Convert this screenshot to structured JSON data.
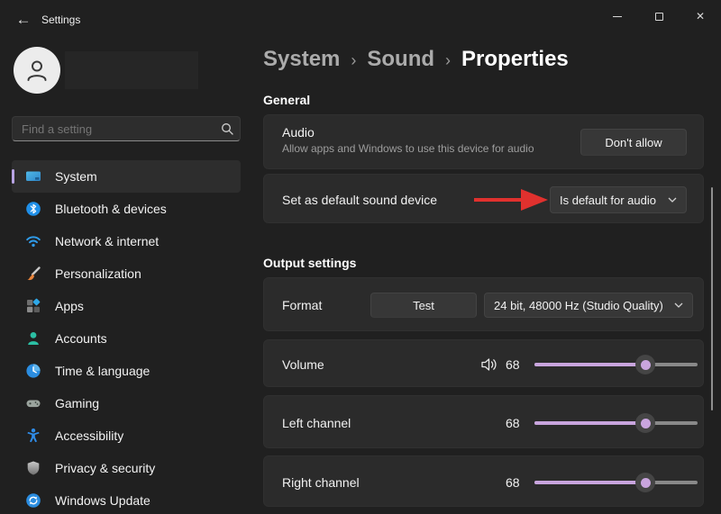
{
  "titlebar": {
    "app_title": "Settings"
  },
  "sidebar": {
    "search_placeholder": "Find a setting",
    "items": [
      {
        "label": "System",
        "icon": "system-icon",
        "selected": true
      },
      {
        "label": "Bluetooth & devices",
        "icon": "bluetooth-icon",
        "selected": false
      },
      {
        "label": "Network & internet",
        "icon": "network-icon",
        "selected": false
      },
      {
        "label": "Personalization",
        "icon": "personalization-icon",
        "selected": false
      },
      {
        "label": "Apps",
        "icon": "apps-icon",
        "selected": false
      },
      {
        "label": "Accounts",
        "icon": "accounts-icon",
        "selected": false
      },
      {
        "label": "Time & language",
        "icon": "time-language-icon",
        "selected": false
      },
      {
        "label": "Gaming",
        "icon": "gaming-icon",
        "selected": false
      },
      {
        "label": "Accessibility",
        "icon": "accessibility-icon",
        "selected": false
      },
      {
        "label": "Privacy & security",
        "icon": "privacy-security-icon",
        "selected": false
      },
      {
        "label": "Windows Update",
        "icon": "windows-update-icon",
        "selected": false
      }
    ]
  },
  "breadcrumb": {
    "part1": "System",
    "part2": "Sound",
    "part3": "Properties",
    "separator": "›"
  },
  "sections": {
    "general": {
      "heading": "General",
      "audio_card": {
        "title": "Audio",
        "description": "Allow apps and Windows to use this device for audio",
        "button_label": "Don't allow"
      },
      "default_device_card": {
        "label": "Set as default sound device",
        "dropdown_value": "Is default for audio"
      }
    },
    "output": {
      "heading": "Output settings",
      "format_card": {
        "label": "Format",
        "test_button_label": "Test",
        "dropdown_value": "24 bit, 48000 Hz (Studio Quality)"
      },
      "volume_card": {
        "label": "Volume",
        "value": "68",
        "percent": 68
      },
      "left_channel_card": {
        "label": "Left channel",
        "value": "68",
        "percent": 68
      },
      "right_channel_card": {
        "label": "Right channel",
        "value": "68",
        "percent": 68
      }
    }
  },
  "colors": {
    "accent": "#c9a5de",
    "annotation_arrow": "#e0312e",
    "window_bg": "#202020",
    "card_bg": "#2b2b2b"
  }
}
